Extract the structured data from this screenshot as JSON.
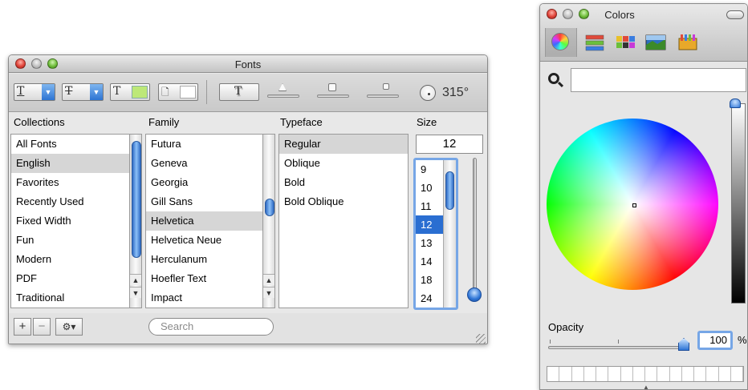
{
  "fonts_window": {
    "title": "Fonts",
    "rotation": "315°",
    "colors": {
      "text_color": "#bde878",
      "doc_color": "#ffffff",
      "selection": "#2a6ed1"
    },
    "columns": {
      "collections": "Collections",
      "family": "Family",
      "typeface": "Typeface",
      "size": "Size"
    },
    "collections": [
      "All Fonts",
      "English",
      "Favorites",
      "Recently Used",
      "Fixed Width",
      "Fun",
      "Modern",
      "PDF",
      "Traditional"
    ],
    "collections_selected": "English",
    "families": [
      "Futura",
      "Geneva",
      "Georgia",
      "Gill Sans",
      "Helvetica",
      "Helvetica Neue",
      "Herculanum",
      "Hoefler Text",
      "Impact"
    ],
    "family_selected": "Helvetica",
    "typefaces": [
      "Regular",
      "Oblique",
      "Bold",
      "Bold Oblique"
    ],
    "typeface_selected": "Regular",
    "size_value": "12",
    "sizes": [
      "9",
      "10",
      "11",
      "12",
      "13",
      "14",
      "18",
      "24"
    ],
    "size_selected": "12",
    "bottom": {
      "add": "+",
      "remove": "−",
      "action": "⚙▾",
      "search_placeholder": "Search"
    }
  },
  "colors_window": {
    "title": "Colors",
    "search_value": "",
    "opacity_label": "Opacity",
    "opacity_value": "100",
    "opacity_unit": "%",
    "modes": [
      "color-wheel",
      "color-sliders",
      "color-palettes",
      "image-palettes",
      "crayons"
    ]
  }
}
